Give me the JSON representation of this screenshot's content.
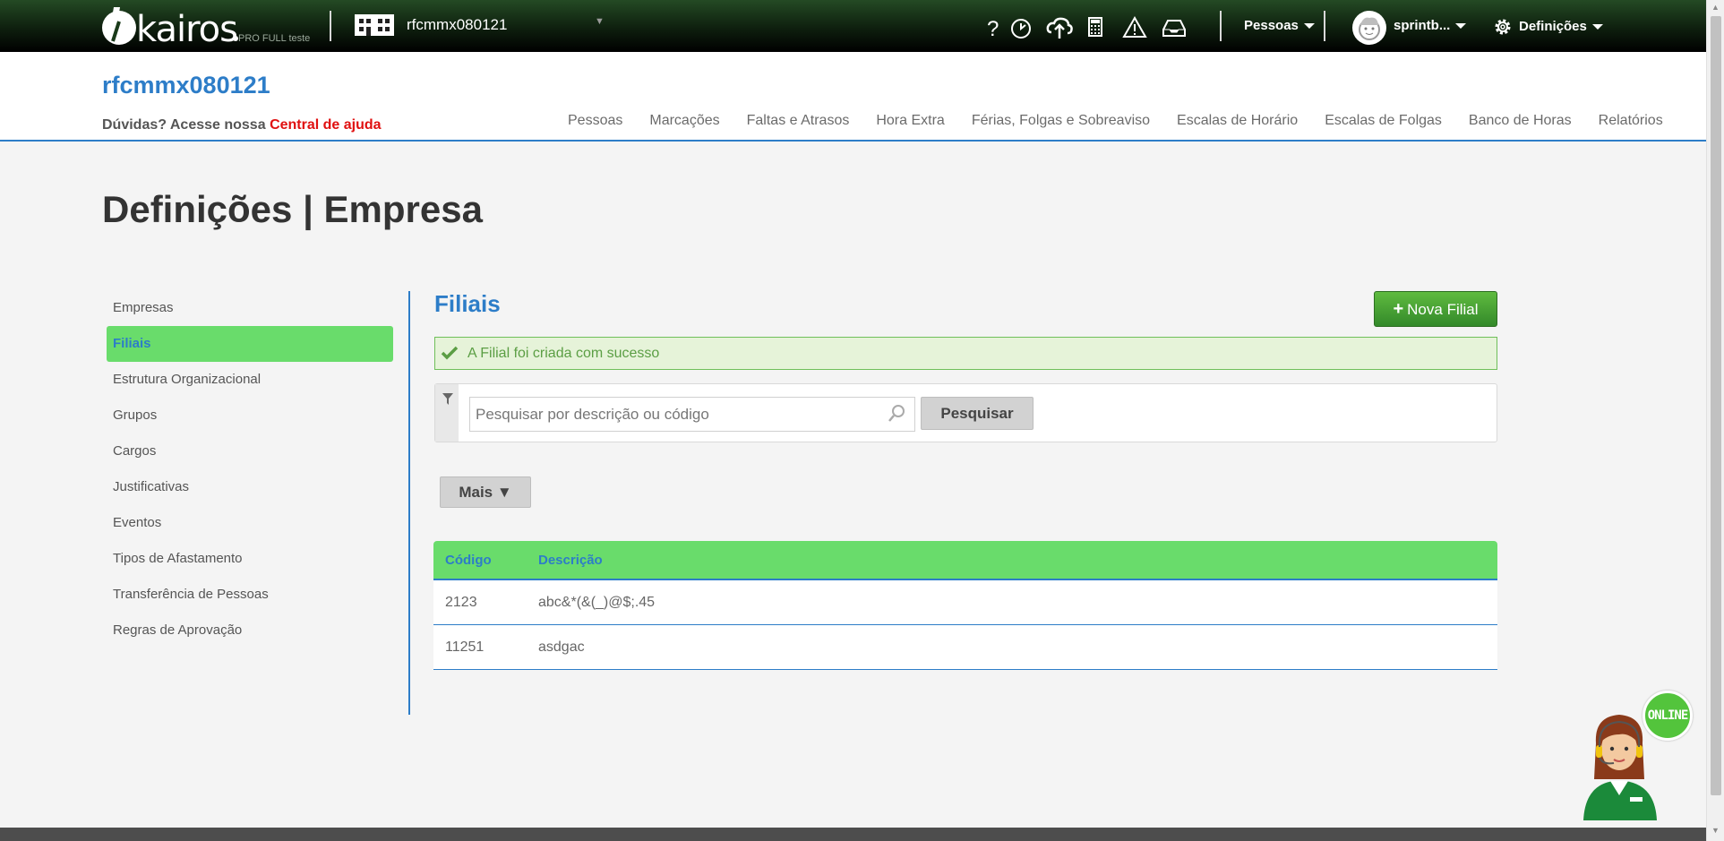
{
  "topbar": {
    "brand": "kairos",
    "brand_sub": "PRO FULL teste",
    "company": "rfcmmx080121",
    "pessoas_menu": "Pessoas",
    "user_menu": "sprintb...",
    "settings_menu": "Definições",
    "icons": [
      "help-icon",
      "clock-icon",
      "cloud-upload-icon",
      "calculator-icon",
      "warning-icon",
      "inbox-icon"
    ]
  },
  "header": {
    "company_title": "rfcmmx080121",
    "help_text": "Dúvidas? Acesse nossa",
    "help_link": "Central de ajuda",
    "nav": [
      "Pessoas",
      "Marcações",
      "Faltas e Atrasos",
      "Hora Extra",
      "Férias, Folgas e Sobreaviso",
      "Escalas de Horário",
      "Escalas de Folgas",
      "Banco de Horas",
      "Relatórios"
    ]
  },
  "page": {
    "title": "Definições | Empresa"
  },
  "sidebar": {
    "items": [
      {
        "label": "Empresas"
      },
      {
        "label": "Filiais"
      },
      {
        "label": "Estrutura Organizacional"
      },
      {
        "label": "Grupos"
      },
      {
        "label": "Cargos"
      },
      {
        "label": "Justificativas"
      },
      {
        "label": "Eventos"
      },
      {
        "label": "Tipos de Afastamento"
      },
      {
        "label": "Transferência de Pessoas"
      },
      {
        "label": "Regras de Aprovação"
      }
    ],
    "active_index": 1
  },
  "content": {
    "title": "Filiais",
    "new_button": "Nova Filial",
    "alert": "A Filial foi criada com sucesso",
    "search": {
      "placeholder": "Pesquisar por descrição ou código",
      "value": "",
      "button": "Pesquisar"
    },
    "more_button": "Mais ▼",
    "table": {
      "headers": [
        "Código",
        "Descrição"
      ],
      "rows": [
        [
          "2123",
          "abc&*(&(_)@$;.45"
        ],
        [
          "11251",
          "asdgac"
        ]
      ]
    }
  },
  "chat": {
    "status": "ONLINE"
  },
  "colors": {
    "accent_blue": "#2d7dc8",
    "active_green": "#69dc6b",
    "button_green": "#3f9f30",
    "help_red": "#e01010"
  }
}
